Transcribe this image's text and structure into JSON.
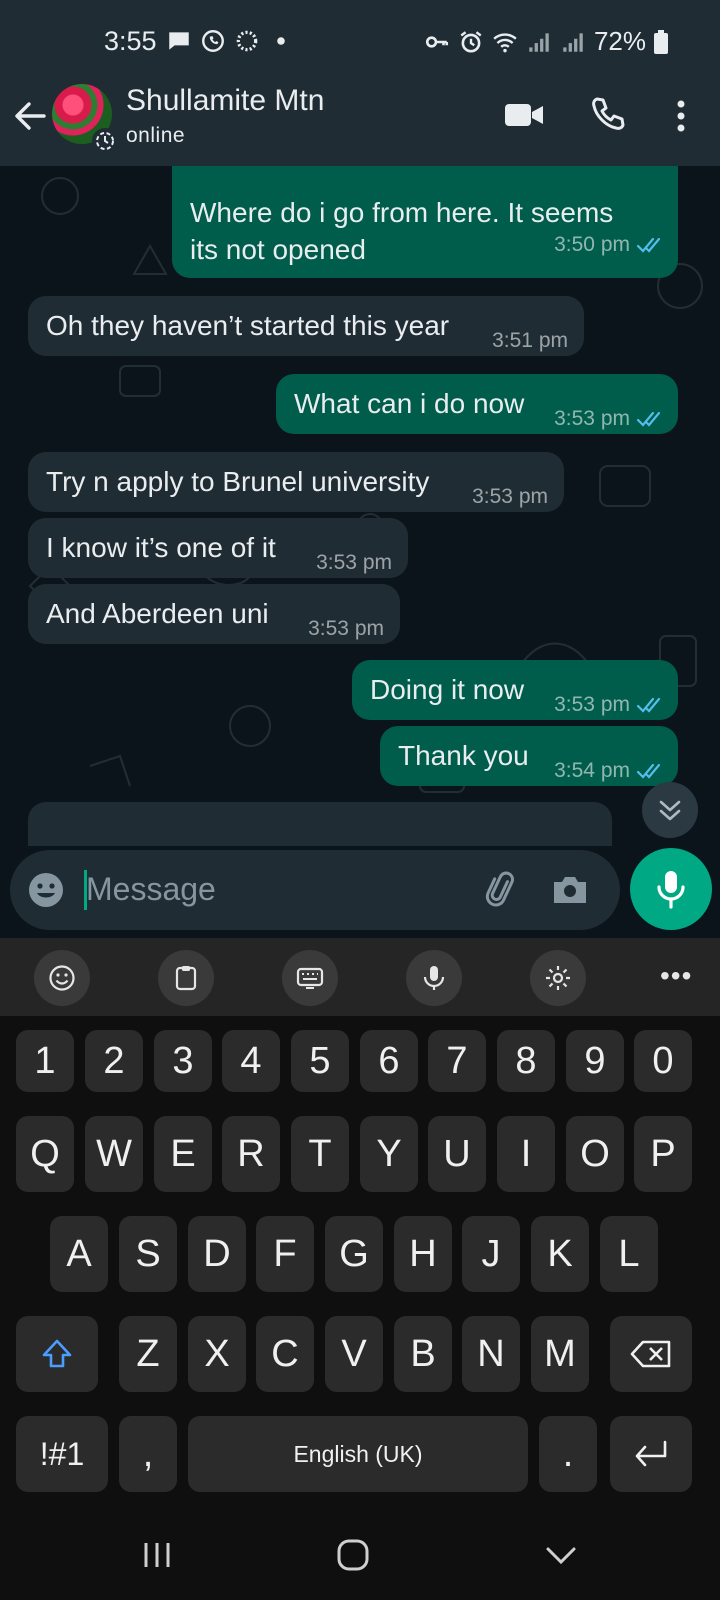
{
  "status_bar": {
    "time": "3:55",
    "battery": "72%",
    "left_icons": [
      "chat-notification-icon",
      "whatsapp-icon",
      "sync-icon",
      "dot-icon"
    ],
    "right_icons": [
      "key-icon",
      "alarm-icon",
      "wifi-icon",
      "signal-icon",
      "signal-icon",
      "battery-icon"
    ]
  },
  "header": {
    "contact_name": "Shullamite Mtn",
    "status": "online"
  },
  "messages": [
    {
      "direction": "out",
      "text_lines": [
        "Where do i go from here. It seems",
        "its not opened"
      ],
      "time": "3:50 pm",
      "read": true,
      "has_image_above": true
    },
    {
      "direction": "in",
      "text": "Oh they haven’t started this year",
      "time": "3:51 pm"
    },
    {
      "direction": "out",
      "text": "What can i do now",
      "time": "3:53 pm",
      "read": true
    },
    {
      "direction": "in",
      "text": "Try n apply to Brunel university",
      "time": "3:53 pm"
    },
    {
      "direction": "in",
      "text": "I know it’s one of it",
      "time": "3:53 pm"
    },
    {
      "direction": "in",
      "text": "And Aberdeen uni",
      "time": "3:53 pm"
    },
    {
      "direction": "out",
      "text": "Doing it now",
      "time": "3:53 pm",
      "read": true
    },
    {
      "direction": "out",
      "text": "Thank you",
      "time": "3:54 pm",
      "read": true
    }
  ],
  "input": {
    "placeholder": "Message"
  },
  "keyboard": {
    "toolbar": [
      "emoji-icon",
      "clipboard-icon",
      "keyboard-icon",
      "voice-icon",
      "settings-icon"
    ],
    "toolbar_more": "•••",
    "number_row": [
      "1",
      "2",
      "3",
      "4",
      "5",
      "6",
      "7",
      "8",
      "9",
      "0"
    ],
    "row1": [
      "Q",
      "W",
      "E",
      "R",
      "T",
      "Y",
      "U",
      "I",
      "O",
      "P"
    ],
    "row2": [
      "A",
      "S",
      "D",
      "F",
      "G",
      "H",
      "J",
      "K",
      "L"
    ],
    "row3": [
      "Z",
      "X",
      "C",
      "V",
      "B",
      "N",
      "M"
    ],
    "symbols_label": "!#1",
    "comma": ",",
    "space_label": "English (UK)",
    "period": "."
  },
  "colors": {
    "header_bg": "#1f2c34",
    "chat_bg": "#0b141a",
    "outgoing_bubble": "#005c4b",
    "incoming_bubble": "#202c33",
    "accent": "#00a884",
    "read_ticks": "#53bdeb"
  }
}
